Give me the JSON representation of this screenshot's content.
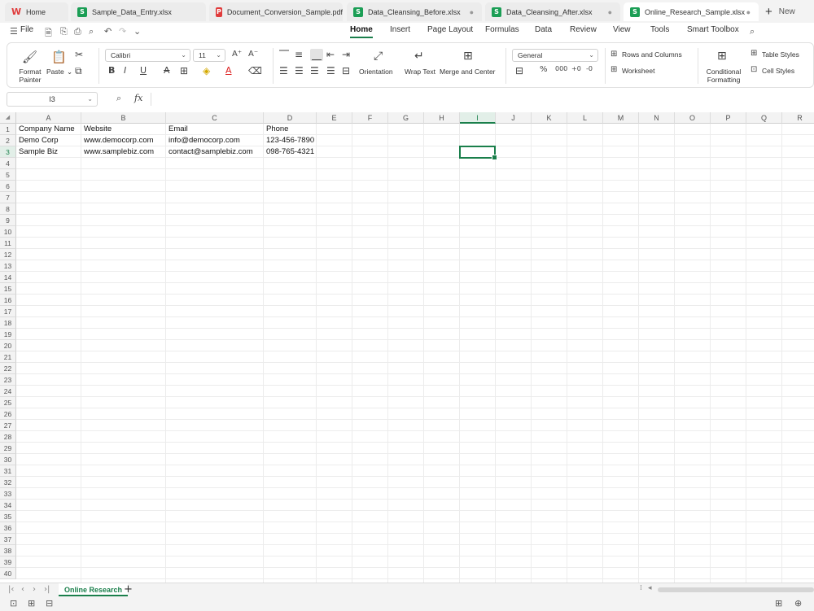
{
  "file_tabs": [
    {
      "label": "Home",
      "type": "wps",
      "active": false
    },
    {
      "label": "Sample_Data_Entry.xlsx",
      "type": "sheet",
      "active": false
    },
    {
      "label": "Document_Conversion_Sample.pdf",
      "type": "pdf",
      "active": false
    },
    {
      "label": "Data_Cleansing_Before.xlsx",
      "type": "sheet",
      "active": false
    },
    {
      "label": "Data_Cleansing_After.xlsx",
      "type": "sheet",
      "active": false
    },
    {
      "label": "Online_Research_Sample.xlsx",
      "type": "sheet",
      "active": true
    }
  ],
  "new_tab_label": "New",
  "menu": {
    "file_label": "File",
    "tabs": [
      "Home",
      "Insert",
      "Page Layout",
      "Formulas",
      "Data",
      "Review",
      "View",
      "Tools",
      "Smart Toolbox"
    ],
    "active_tab": "Home"
  },
  "ribbon": {
    "format_painter": "Format Painter",
    "paste": "Paste",
    "font_name": "Calibri",
    "font_size": "11",
    "bold": "B",
    "italic": "I",
    "underline": "U",
    "orientation": "Orientation",
    "wrap_text": "Wrap Text",
    "merge_center": "Merge and Center",
    "number_format": "General",
    "rows_columns": "Rows and Columns",
    "worksheet": "Worksheet",
    "conditional_formatting": "Conditional Formatting",
    "table_styles": "Table Styles",
    "cell_styles": "Cell Styles"
  },
  "formula_bar": {
    "name_box": "I3",
    "fx": "fx",
    "content": ""
  },
  "columns": [
    "A",
    "B",
    "C",
    "D",
    "E",
    "F",
    "G",
    "H",
    "I",
    "J",
    "K",
    "L",
    "M",
    "N",
    "O",
    "P",
    "Q",
    "R"
  ],
  "selected_column": "I",
  "rows": [
    "1",
    "2",
    "3",
    "4",
    "5",
    "6",
    "7",
    "8",
    "9",
    "10",
    "11",
    "12",
    "13",
    "14",
    "15",
    "16",
    "17",
    "18",
    "19",
    "20",
    "21",
    "22",
    "23",
    "24",
    "25",
    "26",
    "27",
    "28",
    "29",
    "30",
    "31",
    "32",
    "33",
    "34",
    "35",
    "36",
    "37",
    "38",
    "39",
    "40"
  ],
  "selected_row": "3",
  "cells": [
    [
      "Company Name",
      "Website",
      "Email",
      "Phone"
    ],
    [
      "Demo Corp",
      "www.democorp.com",
      "info@democorp.com",
      "123-456-7890"
    ],
    [
      "Sample Biz",
      "www.samplebiz.com",
      "contact@samplebiz.com",
      "098-765-4321"
    ]
  ],
  "sheet_tabs": [
    "Online Research"
  ],
  "active_sheet": "Online Research",
  "accent_color": "#1a7f4b"
}
